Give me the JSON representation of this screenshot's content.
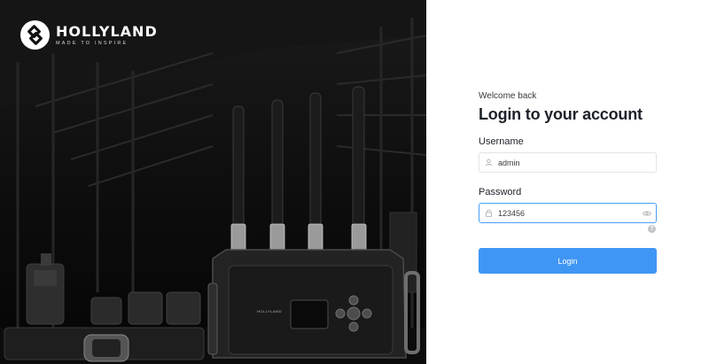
{
  "brand": {
    "name": "HOLLYLAND",
    "tagline": "MADE TO INSPIRE",
    "device_label": "HOLLYLAND"
  },
  "login": {
    "welcome": "Welcome back",
    "title": "Login to your account",
    "username_label": "Username",
    "username_value": "admin",
    "password_label": "Password",
    "password_value": "123456",
    "help_glyph": "?",
    "button_label": "Login"
  },
  "icons": {
    "username": "user-icon",
    "password": "lock-icon",
    "toggle": "eye-icon",
    "help": "question-icon"
  },
  "colors": {
    "accent": "#4096f4",
    "focus_border": "#4a9ff5",
    "text_dark": "#1d2129"
  }
}
